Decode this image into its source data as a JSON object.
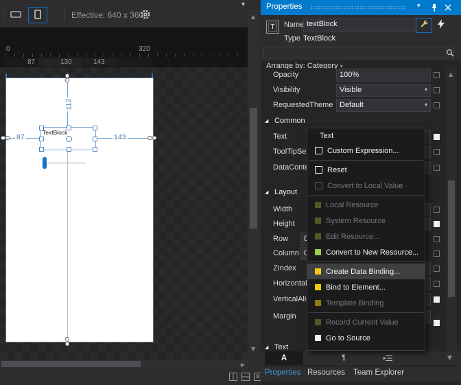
{
  "icons": {
    "dropdown_glyph": "▾",
    "scroll_up_glyph": "▲",
    "scroll_down_glyph": "▼",
    "scroll_right_glyph": "▶",
    "section_glyph": "◢",
    "pane_menu_glyph": "▾"
  },
  "colors": {
    "accent_blue": "#007ACC",
    "selection_blue": "#5B9BD5",
    "binding_yellow": "#F2C811",
    "resource_green": "#9ACD4C",
    "resource_green_dim": "#4C5B26",
    "template_gold_dim": "#8F7A12"
  },
  "left_pane": {
    "toolbar": {
      "effective_label": "Effective: 640 x 360"
    },
    "ruler": {
      "origin": "0",
      "end": "320"
    },
    "segment_labels": [
      "87",
      "130",
      "143"
    ],
    "artboard": {
      "element_label": "TextBlock",
      "dim_left": "87",
      "dim_right": "143",
      "dim_top": "112"
    }
  },
  "properties_panel": {
    "title": "Properties",
    "type_icon_letter": "T",
    "name_label": "Name",
    "name_value": "textBlock",
    "type_label": "Type",
    "type_value": "TextBlock",
    "arrange_by_label": "Arrange by: Category",
    "appearance_rows": [
      {
        "label": "Opacity",
        "value": "100%"
      },
      {
        "label": "Visibility",
        "value": "Visible"
      },
      {
        "label": "RequestedTheme",
        "value": "Default"
      }
    ],
    "common_section": "Common",
    "common_rows": [
      {
        "label": "Text"
      },
      {
        "label": "ToolTipSer"
      },
      {
        "label": "DataConte"
      }
    ],
    "layout_section": "Layout",
    "layout_rows": [
      {
        "label": "Width"
      },
      {
        "label": "Height"
      },
      {
        "label": "Row",
        "value": "0"
      },
      {
        "label": "Column",
        "value": "0"
      },
      {
        "label": "ZIndex"
      },
      {
        "label": "Horizontal"
      },
      {
        "label": "VerticalAlig"
      },
      {
        "label": "Margin"
      }
    ],
    "text_section": "Text",
    "text_toolbar": {
      "char_tab": "A",
      "para_tab": "¶"
    },
    "bottom_tabs": [
      "Properties",
      "Resources",
      "Team Explorer"
    ]
  },
  "context_menu": {
    "header": "Text",
    "items": [
      {
        "label": "Custom Expression...",
        "enabled": true
      },
      {
        "label": "Reset",
        "enabled": true
      },
      {
        "label": "Convert to Local Value",
        "enabled": false
      },
      {
        "label": "Local Resource",
        "enabled": false
      },
      {
        "label": "System Resource",
        "enabled": false
      },
      {
        "label": "Edit Resource...",
        "enabled": false
      },
      {
        "label": "Convert to New Resource...",
        "enabled": true
      },
      {
        "label": "Create Data Binding...",
        "enabled": true,
        "highlighted": true
      },
      {
        "label": "Bind to Element...",
        "enabled": true
      },
      {
        "label": "Template Binding",
        "enabled": false
      },
      {
        "label": "Record Current Value",
        "enabled": false
      },
      {
        "label": "Go to Source",
        "enabled": true
      }
    ]
  }
}
